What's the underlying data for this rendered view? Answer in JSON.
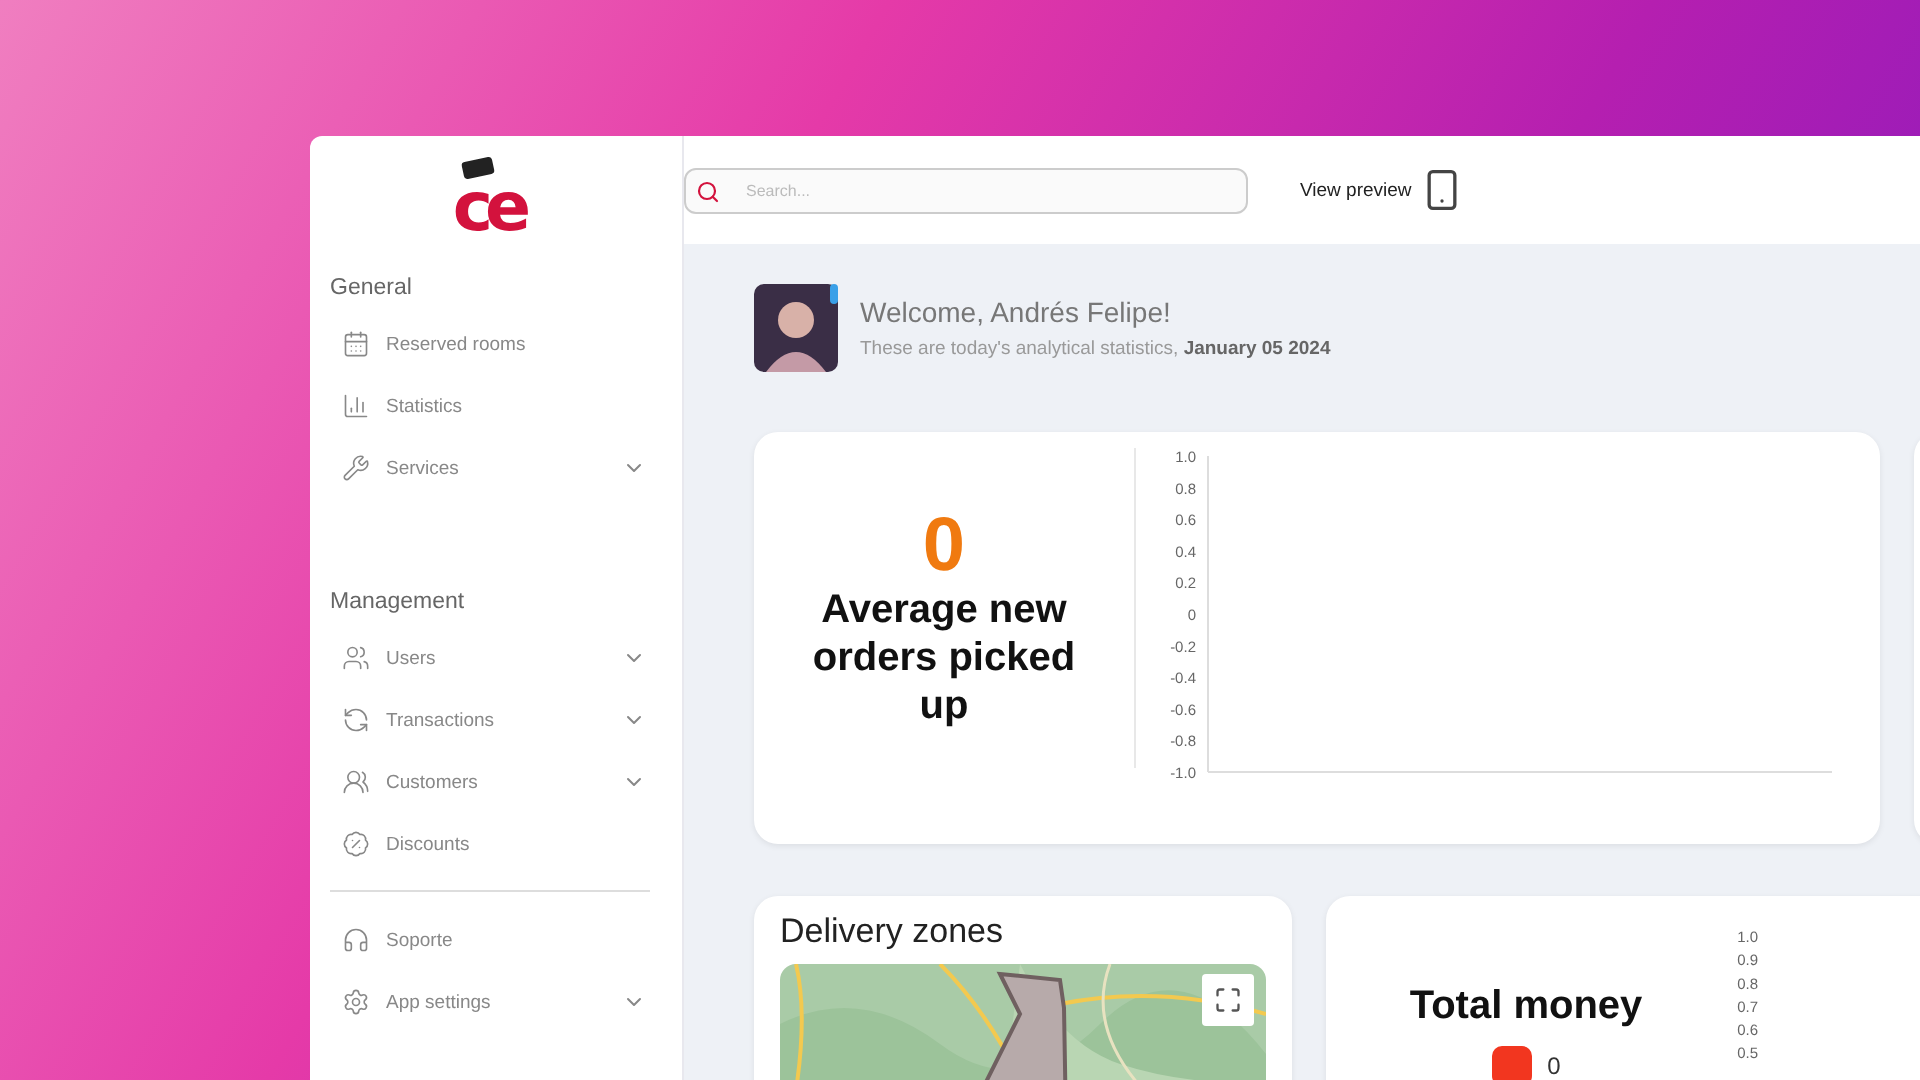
{
  "logo": "ce",
  "sidebar": {
    "sections": [
      {
        "title": "General",
        "items": [
          {
            "label": "Reserved rooms",
            "has_submenu": false
          },
          {
            "label": "Statistics",
            "has_submenu": false
          },
          {
            "label": "Services",
            "has_submenu": true
          }
        ]
      },
      {
        "title": "Management",
        "items": [
          {
            "label": "Users",
            "has_submenu": true
          },
          {
            "label": "Transactions",
            "has_submenu": true
          },
          {
            "label": "Customers",
            "has_submenu": true
          },
          {
            "label": "Discounts",
            "has_submenu": false
          }
        ]
      },
      {
        "items": [
          {
            "label": "Soporte",
            "has_submenu": false
          },
          {
            "label": "App settings",
            "has_submenu": true
          }
        ]
      }
    ]
  },
  "topbar": {
    "search": {
      "placeholder": "Search..."
    },
    "preview_label": "View preview"
  },
  "welcome": {
    "title": "Welcome, Andrés Felipe!",
    "subtitle": "These are today's analytical statistics, **January 05 2024**"
  },
  "orders_card": {
    "value": "0",
    "label": "Average new orders picked up",
    "axis_labels": [
      "1.0",
      "0.8",
      "0.6",
      "0.4",
      "0.2",
      "0",
      "-0.2",
      "-0.4",
      "-0.6",
      "-0.8",
      "-1.0"
    ]
  },
  "delivery_card": {
    "title": "Delivery zones"
  },
  "money_card": {
    "title": "Total money",
    "legend": [
      {
        "label": "0",
        "color": "#f2361f"
      }
    ],
    "axis_labels": [
      "1.0",
      "0.9",
      "0.8",
      "0.7",
      "0.6",
      "0.5"
    ]
  }
}
